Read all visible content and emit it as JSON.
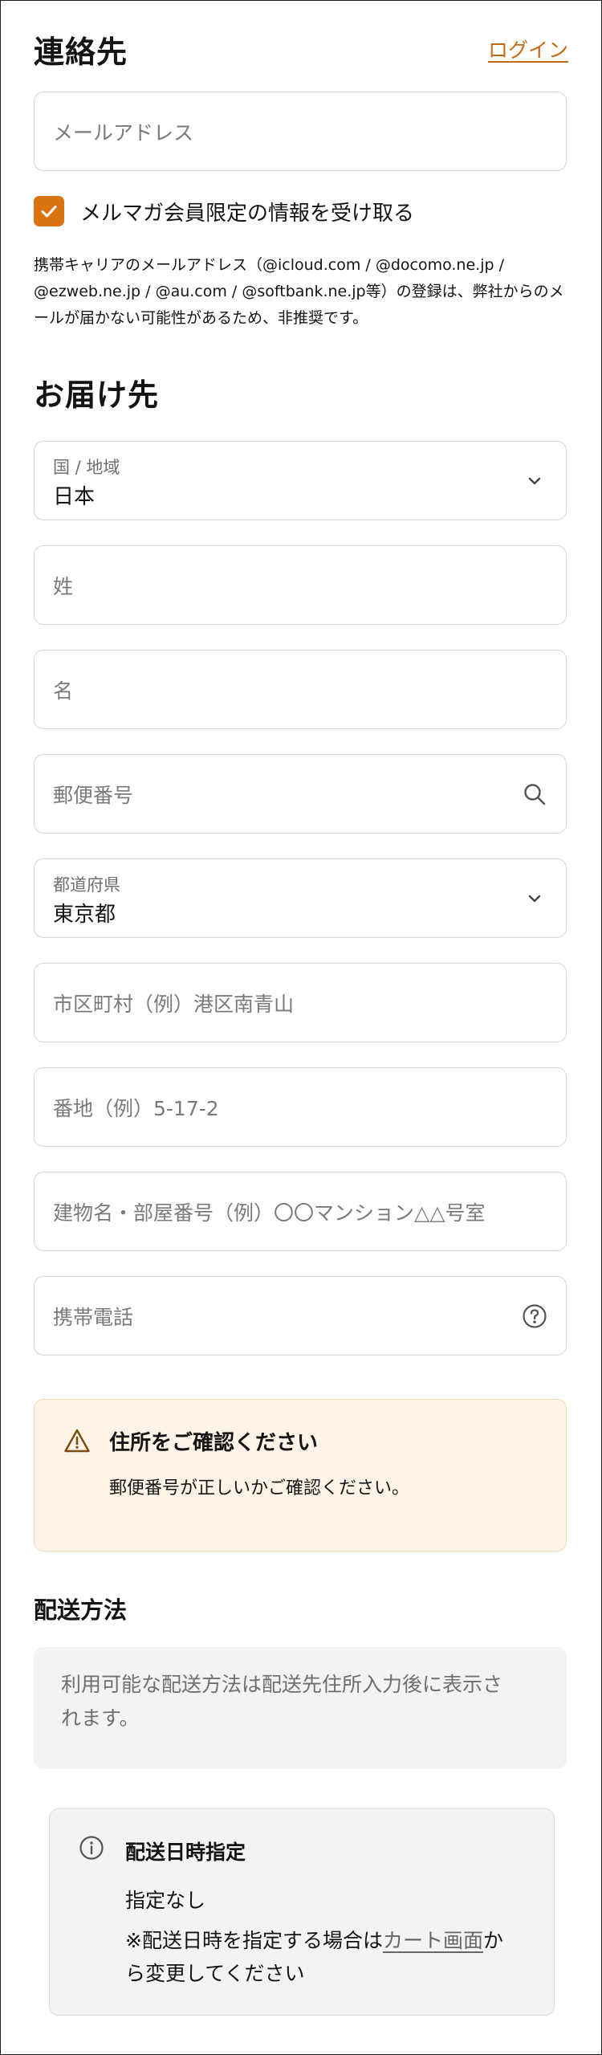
{
  "contact": {
    "heading": "連絡先",
    "login_link": "ログイン",
    "email_placeholder": "メールアドレス",
    "newsletter_label": "メルマガ会員限定の情報を受け取る",
    "newsletter_checked": true,
    "note_line1": "携帯キャリアのメールアドレス（@icloud.com / @docomo.ne.jp /",
    "note_line2": "@ezweb.ne.jp / @au.com / @softbank.ne.jp等）の登録は、弊社からのメ",
    "note_line3": "ールが届かない可能性があるため、非推奨です。"
  },
  "delivery": {
    "heading": "お届け先",
    "country_label": "国 / 地域",
    "country_value": "日本",
    "last_name_placeholder": "姓",
    "first_name_placeholder": "名",
    "postal_placeholder": "郵便番号",
    "prefecture_label": "都道府県",
    "prefecture_value": "東京都",
    "city_placeholder": "市区町村（例）港区南青山",
    "street_placeholder": "番地（例）5-17-2",
    "building_placeholder": "建物名・部屋番号（例）〇〇マンション△△号室",
    "phone_placeholder": "携帯電話"
  },
  "warning": {
    "title": "住所をご確認ください",
    "text": "郵便番号が正しいかご確認ください。",
    "accent_color": "#d97211"
  },
  "shipping": {
    "heading": "配送方法",
    "line1": "利用可能な配送方法は配送先住所入力後に表示さ",
    "line2": "れます。"
  },
  "delivery_date": {
    "title": "配送日時指定",
    "value": "指定なし",
    "note_prefix": "※配送日時を指定する場合は",
    "note_link": "カート画面",
    "note_suffix_1": "か",
    "note_suffix_2": "ら変更してください"
  },
  "icons": {
    "checkbox": "check-icon",
    "country_select": "chevron-down-icon",
    "postal_search": "search-icon",
    "prefecture_select": "chevron-down-icon",
    "phone_help": "question-icon",
    "warning": "warning-icon",
    "info": "info-icon"
  },
  "colors": {
    "brand": "#d97211",
    "warning_bg": "#fdf3e7"
  }
}
